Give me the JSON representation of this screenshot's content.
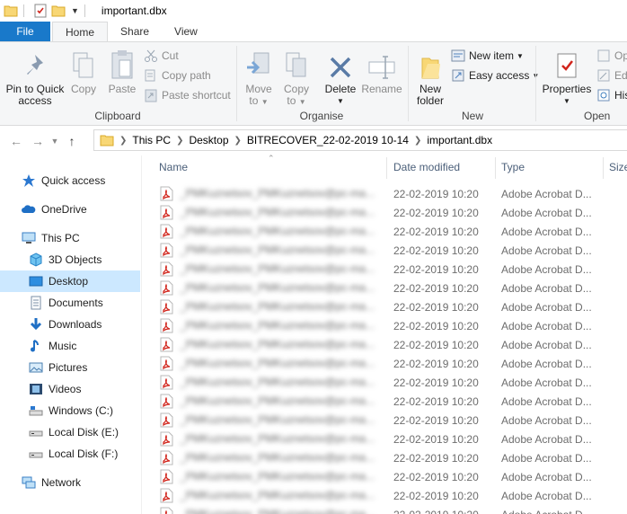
{
  "window": {
    "title": "important.dbx"
  },
  "tabs": {
    "file": "File",
    "home": "Home",
    "share": "Share",
    "view": "View"
  },
  "ribbon": {
    "clipboard": {
      "label": "Clipboard",
      "pin_line1": "Pin to Quick",
      "pin_line2": "access",
      "copy": "Copy",
      "paste": "Paste",
      "cut": "Cut",
      "copy_path": "Copy path",
      "paste_shortcut": "Paste shortcut"
    },
    "organise": {
      "label": "Organise",
      "move_line1": "Move",
      "move_line2": "to",
      "copy_line1": "Copy",
      "copy_line2": "to",
      "delete": "Delete",
      "rename": "Rename"
    },
    "new": {
      "label": "New",
      "new_folder_line1": "New",
      "new_folder_line2": "folder",
      "new_item": "New item",
      "easy_access": "Easy access"
    },
    "open": {
      "label": "Open",
      "properties": "Properties",
      "open_partial": "Op",
      "edit_partial": "Edi",
      "history_partial": "His"
    }
  },
  "address": {
    "crumbs": [
      "This PC",
      "Desktop",
      "BITRECOVER_22-02-2019 10-14",
      "important.dbx"
    ]
  },
  "navpane": {
    "items": [
      {
        "label": "Quick access",
        "icon": "star-icon"
      },
      {
        "label": "OneDrive",
        "icon": "cloud-icon"
      },
      {
        "label": "This PC",
        "icon": "computer-icon"
      },
      {
        "label": "3D Objects",
        "icon": "cube-icon"
      },
      {
        "label": "Desktop",
        "icon": "desktop-icon"
      },
      {
        "label": "Documents",
        "icon": "document-icon"
      },
      {
        "label": "Downloads",
        "icon": "download-icon"
      },
      {
        "label": "Music",
        "icon": "music-icon"
      },
      {
        "label": "Pictures",
        "icon": "picture-icon"
      },
      {
        "label": "Videos",
        "icon": "video-icon"
      },
      {
        "label": "Windows (C:)",
        "icon": "windows-drive-icon"
      },
      {
        "label": "Local Disk (E:)",
        "icon": "drive-icon"
      },
      {
        "label": "Local Disk (F:)",
        "icon": "drive-icon"
      },
      {
        "label": "Network",
        "icon": "network-icon"
      }
    ],
    "selected": "Desktop"
  },
  "columns": {
    "name": "Name",
    "date": "Date modified",
    "type": "Type",
    "size": "Size"
  },
  "files": [
    {
      "name": "_PMKuznetsov_PMKuznetsov@pc-ma...",
      "date": "22-02-2019 10:20",
      "type": "Adobe Acrobat D..."
    },
    {
      "name": "_PMKuznetsov_PMKuznetsov@pc-ma...",
      "date": "22-02-2019 10:20",
      "type": "Adobe Acrobat D..."
    },
    {
      "name": "_PMKuznetsov_PMKuznetsov@pc-ma...",
      "date": "22-02-2019 10:20",
      "type": "Adobe Acrobat D..."
    },
    {
      "name": "_PMKuznetsov_PMKuznetsov@pc-ma...",
      "date": "22-02-2019 10:20",
      "type": "Adobe Acrobat D..."
    },
    {
      "name": "_PMKuznetsov_PMKuznetsov@pc-ma...",
      "date": "22-02-2019 10:20",
      "type": "Adobe Acrobat D..."
    },
    {
      "name": "_PMKuznetsov_PMKuznetsov@pc-ma...",
      "date": "22-02-2019 10:20",
      "type": "Adobe Acrobat D..."
    },
    {
      "name": "_PMKuznetsov_PMKuznetsov@pc-ma...",
      "date": "22-02-2019 10:20",
      "type": "Adobe Acrobat D..."
    },
    {
      "name": "_PMKuznetsov_PMKuznetsov@pc-ma...",
      "date": "22-02-2019 10:20",
      "type": "Adobe Acrobat D..."
    },
    {
      "name": "_PMKuznetsov_PMKuznetsov@pc-ma...",
      "date": "22-02-2019 10:20",
      "type": "Adobe Acrobat D..."
    },
    {
      "name": "_PMKuznetsov_PMKuznetsov@pc-ma...",
      "date": "22-02-2019 10:20",
      "type": "Adobe Acrobat D..."
    },
    {
      "name": "_PMKuznetsov_PMKuznetsov@pc-ma...",
      "date": "22-02-2019 10:20",
      "type": "Adobe Acrobat D..."
    },
    {
      "name": "_PMKuznetsov_PMKuznetsov@pc-ma...",
      "date": "22-02-2019 10:20",
      "type": "Adobe Acrobat D..."
    },
    {
      "name": "_PMKuznetsov_PMKuznetsov@pc-ma...",
      "date": "22-02-2019 10:20",
      "type": "Adobe Acrobat D..."
    },
    {
      "name": "_PMKuznetsov_PMKuznetsov@pc-ma...",
      "date": "22-02-2019 10:20",
      "type": "Adobe Acrobat D..."
    },
    {
      "name": "_PMKuznetsov_PMKuznetsov@pc-ma...",
      "date": "22-02-2019 10:20",
      "type": "Adobe Acrobat D..."
    },
    {
      "name": "_PMKuznetsov_PMKuznetsov@pc-ma...",
      "date": "22-02-2019 10:20",
      "type": "Adobe Acrobat D..."
    },
    {
      "name": "_PMKuznetsov_PMKuznetsov@pc-ma...",
      "date": "22-02-2019 10:20",
      "type": "Adobe Acrobat D..."
    },
    {
      "name": "_PMKuznetsov_PMKuznetsov@pc-ma...",
      "date": "22-02-2019 10:20",
      "type": "Adobe Acrobat D..."
    }
  ],
  "colors": {
    "file_tab": "#1979ca",
    "selected": "#cce8ff",
    "header_text": "#4c607a",
    "pdf_red": "#d1251c"
  }
}
